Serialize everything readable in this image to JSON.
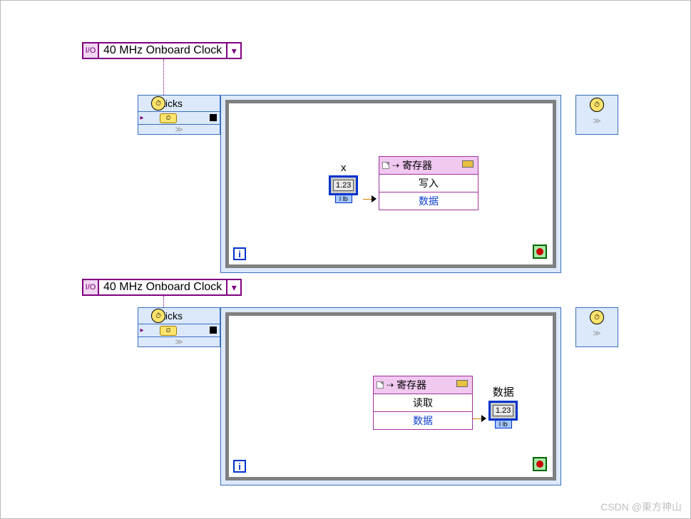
{
  "clock1": {
    "io": "I/O",
    "label": "40 MHz Onboard Clock",
    "dd": "▾"
  },
  "clock2": {
    "io": "I/O",
    "label": "40 MHz Onboard Clock",
    "dd": "▾"
  },
  "loop1": {
    "ticks_label": "ticks",
    "clk_glyph": "⏱",
    "timer_glyph": "⏲",
    "chevron": "≫",
    "iter": "i",
    "control": {
      "label": "x",
      "value": "1.23",
      "tag": "I lb"
    },
    "register": {
      "title": "寄存器",
      "arrow": "⇢",
      "op": "写入",
      "field": "数据"
    }
  },
  "loop2": {
    "ticks_label": "ticks",
    "clk_glyph": "⏱",
    "timer_glyph": "⏲",
    "chevron": "≫",
    "iter": "i",
    "register": {
      "title": "寄存器",
      "arrow": "⇢",
      "op": "读取",
      "field": "数据"
    },
    "indicator": {
      "label": "数据",
      "value": "1.23",
      "tag": "I lb"
    }
  },
  "watermark": "CSDN @東方神山"
}
